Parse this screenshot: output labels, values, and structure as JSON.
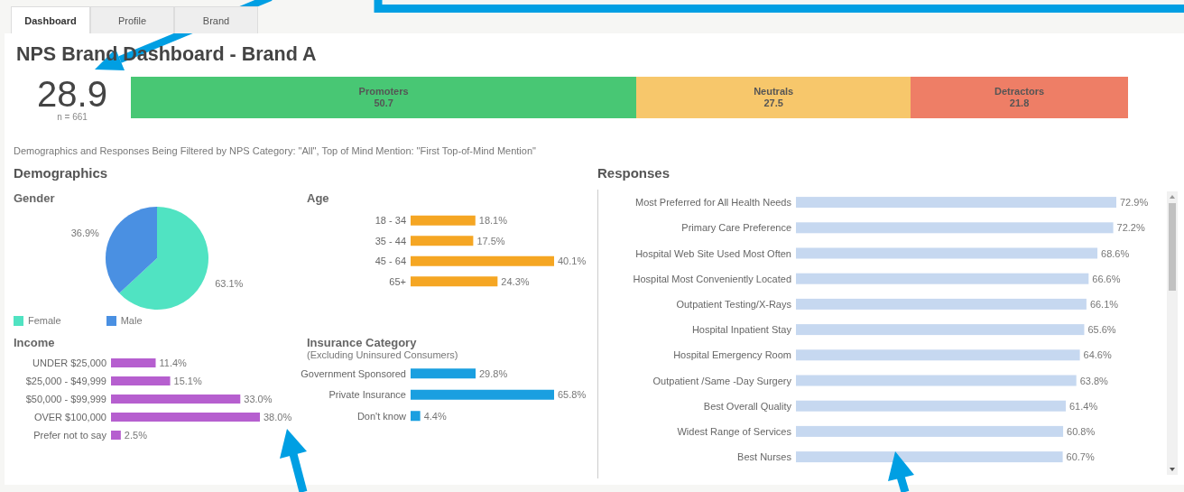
{
  "tabs": [
    {
      "label": "Dashboard",
      "selected": true
    },
    {
      "label": "Profile",
      "selected": false
    },
    {
      "label": "Brand",
      "selected": false
    }
  ],
  "title": "NPS Brand Dashboard - Brand A",
  "nps": {
    "score": "28.9",
    "sample": "n = 661",
    "segments": [
      {
        "label": "Promoters",
        "value": "50.7",
        "color": "#48c774"
      },
      {
        "label": "Neutrals",
        "value": "27.5",
        "color": "#f7c76b"
      },
      {
        "label": "Detractors",
        "value": "21.8",
        "color": "#ee7e66"
      }
    ]
  },
  "filter_note": "Demographics and Responses Being Filtered by NPS Category: \"All\", Top of Mind Mention: \"First Top-of-Mind Mention\"",
  "demographics": {
    "heading": "Demographics",
    "gender": {
      "heading": "Gender",
      "legend": [
        {
          "color": "#50e3c2"
        },
        {
          "color": "#4a90e2"
        }
      ],
      "chart_data": {
        "type": "pie",
        "categories": [
          "Female",
          "Male"
        ],
        "values": [
          63.1,
          36.9
        ],
        "value_labels": [
          "63.1%",
          "36.9%"
        ]
      }
    },
    "age": {
      "heading": "Age",
      "chart_data": {
        "type": "bar",
        "orientation": "horizontal",
        "categories": [
          "18 - 34",
          "35 - 44",
          "45 - 64",
          "65+"
        ],
        "series": [
          {
            "color": "#f5a623",
            "values": [
              18.1,
              17.5,
              40.1,
              24.3
            ],
            "value_labels": [
              "18.1%",
              "17.5%",
              "40.1%",
              "24.3%"
            ]
          }
        ]
      }
    },
    "income": {
      "heading": "Income",
      "chart_data": {
        "type": "bar",
        "orientation": "horizontal",
        "categories": [
          "UNDER $25,000",
          "$25,000 - $49,999",
          "$50,000 - $99,999",
          "OVER $100,000",
          "Prefer not to say"
        ],
        "series": [
          {
            "color": "#b65fcf",
            "values": [
              11.4,
              15.1,
              33.0,
              38.0,
              2.5
            ],
            "value_labels": [
              "11.4%",
              "15.1%",
              "33.0%",
              "38.0%",
              "2.5%"
            ]
          }
        ]
      }
    },
    "insurance": {
      "heading": "Insurance Category",
      "subheading": "(Excluding Uninsured Consumers)",
      "chart_data": {
        "type": "bar",
        "orientation": "horizontal",
        "categories": [
          "Government Sponsored",
          "Private Insurance",
          "Don't know"
        ],
        "series": [
          {
            "color": "#1a9fe0",
            "values": [
              29.8,
              65.8,
              4.4
            ],
            "value_labels": [
              "29.8%",
              "65.8%",
              "4.4%"
            ]
          }
        ]
      }
    }
  },
  "responses": {
    "heading": "Responses",
    "chart_data": {
      "type": "bar",
      "orientation": "horizontal",
      "categories": [
        "Most Preferred for All Health Needs",
        "Primary Care Preference",
        "Hospital Web Site Used Most Often",
        "Hospital Most Conveniently Located",
        "Outpatient Testing/X-Rays",
        "Hospital Inpatient Stay",
        "Hospital Emergency Room",
        "Outpatient /Same -Day Surgery",
        "Best Overall Quality",
        "Widest Range of Services",
        "Best Nurses"
      ],
      "series": [
        {
          "color": "#c6d8f0",
          "values": [
            72.9,
            72.2,
            68.6,
            66.6,
            66.1,
            65.6,
            64.6,
            63.8,
            61.4,
            60.8,
            60.7
          ],
          "value_labels": [
            "72.9%",
            "72.2%",
            "68.6%",
            "66.6%",
            "66.1%",
            "65.6%",
            "64.6%",
            "63.8%",
            "61.4%",
            "60.8%",
            "60.7%"
          ]
        }
      ]
    }
  }
}
